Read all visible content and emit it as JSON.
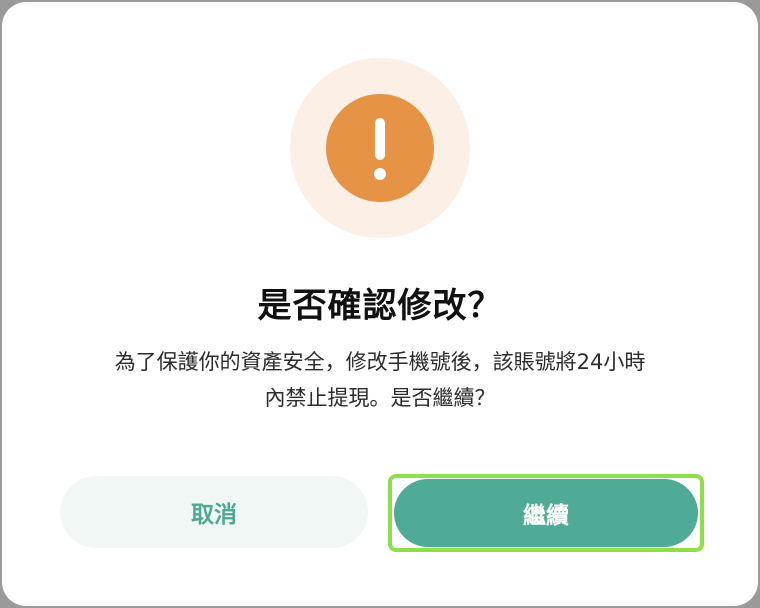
{
  "dialog": {
    "icon": "exclamation-icon",
    "title": "是否確認修改？",
    "message_lines": [
      "為了保護你的資產安全，修改手機號後，該賬號將24小時",
      "內禁止提現。是否繼續？"
    ],
    "buttons": {
      "cancel_label": "取消",
      "continue_label": "繼續"
    }
  },
  "colors": {
    "warning_orange": "#e69345",
    "warning_halo": "#fcefe6",
    "primary_green": "#4fab96",
    "cancel_bg": "#f1f7f5",
    "focus_ring": "#8ee04b"
  }
}
